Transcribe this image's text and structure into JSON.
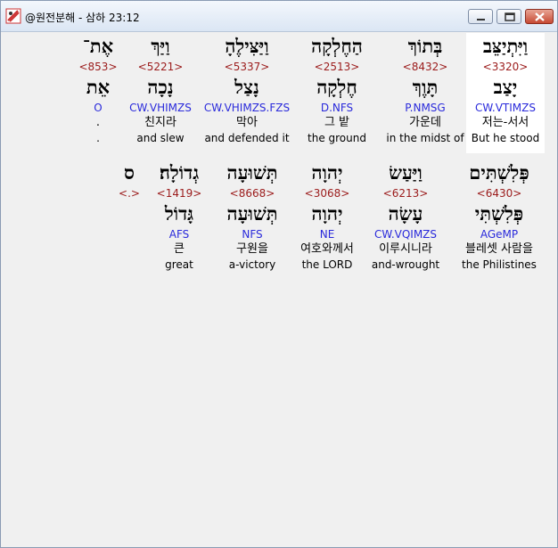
{
  "window": {
    "title": "@원전분해 - 삼하 23:12",
    "controls": [
      "minimize-icon",
      "maximize-icon",
      "close-icon"
    ]
  },
  "row1": [
    {
      "heb": "וַיִּתְיַצֵּב",
      "strong": "<3320>",
      "lemma": "יָצַב",
      "morph": "CW.VTIMZS",
      "kor": "저는-서서",
      "eng": "But he stood"
    },
    {
      "heb": "בְּתוֹךְ",
      "strong": "<8432>",
      "lemma": "תָּוֶךְ",
      "morph": "P.NMSG",
      "kor": "가운데",
      "eng": "in the midst of"
    },
    {
      "heb": "הַחֶלְקָה",
      "strong": "<2513>",
      "lemma": "חֶלְקָה",
      "morph": "D.NFS",
      "kor": "그 밭",
      "eng": "the ground"
    },
    {
      "heb": "וַיַּצִּילֶהָ",
      "strong": "<5337>",
      "lemma": "נָצַל",
      "morph": "CW.VHIMZS.FZS",
      "kor": "막아",
      "eng": "and defended it"
    },
    {
      "heb": "וַיַּךְ",
      "strong": "<5221>",
      "lemma": "נָכָה",
      "morph": "CW.VHIMZS",
      "kor": "친지라",
      "eng": "and slew"
    },
    {
      "heb": "אֶת־",
      "strong": "<853>",
      "lemma": "אֵת",
      "morph": "O",
      "kor": ".",
      "eng": "."
    }
  ],
  "row2": [
    {
      "heb": "פְּלִשְׁתִּים",
      "strong": "<6430>",
      "lemma": "פְּלִשְׁתִּי",
      "morph": "AGeMP",
      "kor": "블레셋 사람을",
      "eng": "the Philistines"
    },
    {
      "heb": "וַיַּעַשׂ",
      "strong": "<6213>",
      "lemma": "עָשָׂה",
      "morph": "CW.VQIMZS",
      "kor": "이루시니라",
      "eng": "and-wrought"
    },
    {
      "heb": "יְהוָה",
      "strong": "<3068>",
      "lemma": "יְהוָה",
      "morph": "NE",
      "kor": "여호와께서",
      "eng": "the LORD"
    },
    {
      "heb": "תְּשׁוּעָה",
      "strong": "<8668>",
      "lemma": "תְּשׁוּעָה",
      "morph": "NFS",
      "kor": "구원을",
      "eng": "a-victory"
    },
    {
      "heb": "גְדוֹלָה׃",
      "strong": "<1419>",
      "lemma": "גָּדוֹל",
      "morph": "AFS",
      "kor": "큰",
      "eng": "great"
    },
    {
      "heb": "ס",
      "strong": "<.>",
      "lemma": "",
      "morph": "",
      "kor": "",
      "eng": ""
    }
  ],
  "colors": {
    "strong": "#9b1b1b",
    "morph": "#2a2adb",
    "highlight": "#ffffff"
  }
}
